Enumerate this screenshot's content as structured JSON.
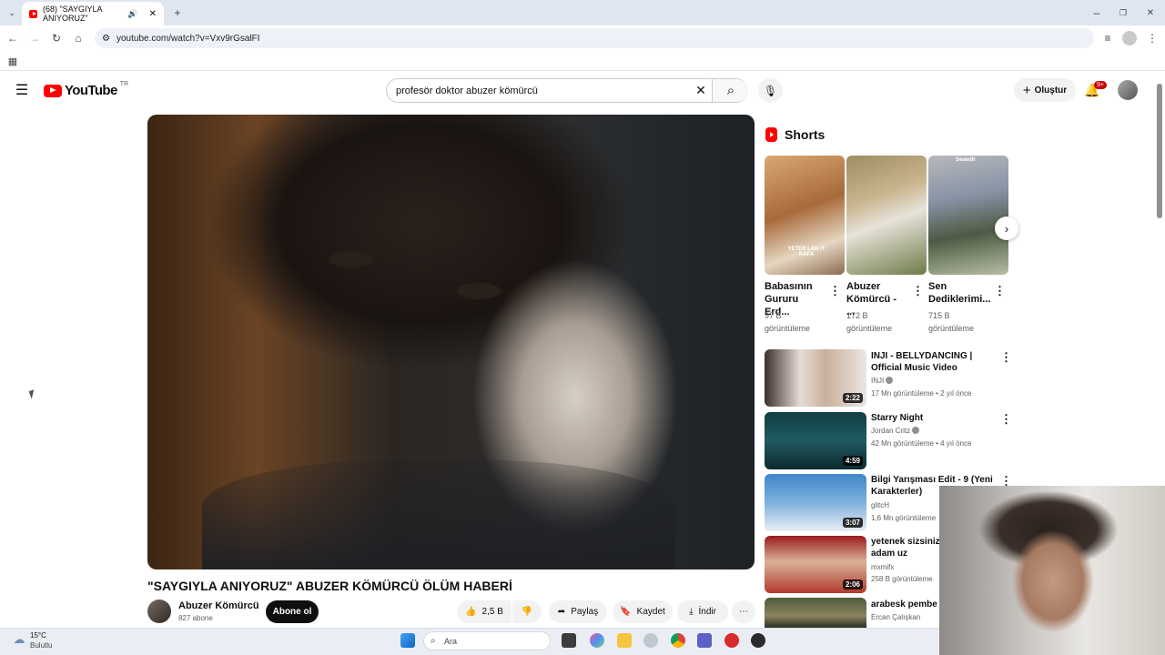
{
  "browser": {
    "tab_title": "(68) \"SAYGIYLA ANIYORUZ\"",
    "url": "youtube.com/watch?v=Vxv9rGsalFI"
  },
  "header": {
    "logo_text": "YouTube",
    "region": "TR",
    "search_value": "profesör doktor abuzer kömürcü",
    "create_label": "Oluştur",
    "notification_count": "9+"
  },
  "video": {
    "title": "\"SAYGIYLA ANIYORUZ\" ABUZER KÖMÜRCÜ ÖLÜM HABERİ",
    "channel": "Abuzer Kömürcü",
    "subscribers": "827 abone",
    "subscribe_label": "Abone ol",
    "like_count": "2,5 B",
    "share_label": "Paylaş",
    "save_label": "Kaydet",
    "download_label": "İndir"
  },
  "shorts": {
    "heading": "Shorts",
    "items": [
      {
        "title": "Babasının Gururu Erd...",
        "views": "97 B görüntüleme",
        "overlay": "YETER LAN İT KAFA"
      },
      {
        "title": "Abuzer Kömürcü - ...",
        "views": "172 B görüntüleme",
        "overlay": ""
      },
      {
        "title": "Sen Dediklerimi...",
        "views": "715 B görüntüleme",
        "overlay": "Seaedit"
      }
    ]
  },
  "related": [
    {
      "title": "INJI - BELLYDANCING | Official Music Video",
      "channel": "INJI",
      "meta": "17 Mn görüntüleme • 2 yıl önce",
      "duration": "2:22",
      "verified": true
    },
    {
      "title": "Starry Night",
      "channel": "Jordan Critz",
      "meta": "42 Mn görüntüleme • 4 yıl önce",
      "duration": "4:59",
      "verified": true
    },
    {
      "title": "Bilgi Yarışması Edit - 9 (Yeni Karakterler)",
      "channel": "glitcH",
      "meta": "1,6 Mn görüntüleme",
      "duration": "3:07",
      "verified": false
    },
    {
      "title": "yetenek sizsiniz fa söyleyen adam uz",
      "channel": "mxmifx",
      "meta": "258 B görüntüleme",
      "duration": "2:06",
      "verified": false
    },
    {
      "title": "arabesk pembe m",
      "channel": "Ercan Çalışkan",
      "meta": "",
      "duration": "",
      "verified": false
    }
  ],
  "taskbar": {
    "weather_temp": "15°C",
    "weather_desc": "Bulutlu",
    "search_placeholder": "Ara"
  },
  "colors": {
    "brand_red": "#ff0000",
    "subscribe_bg": "#0f0f0f"
  }
}
